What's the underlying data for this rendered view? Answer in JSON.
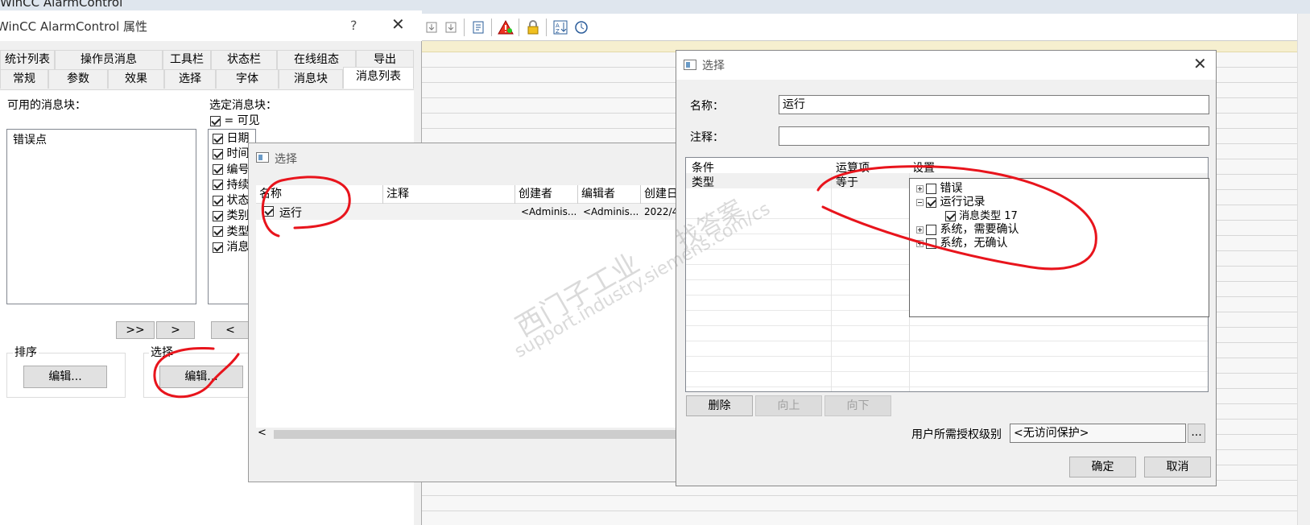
{
  "app": {
    "title": "WinCC AlarmControl"
  },
  "toolbar": {
    "icons": [
      "import-icon",
      "export-icon",
      "properties-icon",
      "alarm-warning-icon",
      "lock-icon",
      "sort-icon",
      "time-base-icon"
    ]
  },
  "properties_dialog": {
    "title": "WinCC AlarmControl 属性",
    "help": "?",
    "close": "✕",
    "tabs_row1": [
      "统计列表",
      "操作员消息",
      "工具栏",
      "状态栏",
      "在线组态",
      "导出"
    ],
    "tabs_row2": [
      "常规",
      "参数",
      "效果",
      "选择",
      "字体",
      "消息块",
      "消息列表"
    ],
    "active_tab": "消息列表",
    "available_label": "可用的消息块：",
    "available_items": [
      "错误点"
    ],
    "selected_label": "选定消息块：",
    "visible_legend": "= 可见",
    "selected_items": [
      {
        "label": "日期",
        "checked": true
      },
      {
        "label": "时间",
        "checked": true
      },
      {
        "label": "编号",
        "checked": true
      },
      {
        "label": "持续",
        "checked": true
      },
      {
        "label": "状态",
        "checked": true
      },
      {
        "label": "类别",
        "checked": true
      },
      {
        "label": "类型",
        "checked": true
      },
      {
        "label": "消息",
        "checked": true
      }
    ],
    "btn_add_all": ">>",
    "btn_add": ">",
    "btn_remove": "<",
    "sort_group": "排序",
    "sort_edit": "编辑...",
    "select_group": "选择",
    "select_edit": "编辑..."
  },
  "selection_dialog": {
    "title": "选择",
    "columns": [
      "名称",
      "注释",
      "创建者",
      "编辑者",
      "创建日"
    ],
    "rows": [
      {
        "checked": true,
        "name": "运行",
        "comment": "",
        "creator": "<Adminis...",
        "editor": "<Adminis...",
        "created": "2022/4"
      }
    ],
    "scroll_left": "<"
  },
  "selection_editor": {
    "title": "选择",
    "close": "✕",
    "name_label": "名称：",
    "name_value": "运行",
    "comment_label": "注释：",
    "comment_value": "",
    "grid_headers": [
      "条件",
      "运算项",
      "设置"
    ],
    "grid_rows": [
      {
        "condition": "类型",
        "operator": "等于"
      }
    ],
    "tree": [
      {
        "label": "错误",
        "expander": "plus",
        "checked": false,
        "level": 0
      },
      {
        "label": "运行记录",
        "expander": "minus",
        "checked": true,
        "level": 0
      },
      {
        "label": "消息类型 17",
        "expander": "none",
        "checked": true,
        "level": 1
      },
      {
        "label": "系统，需要确认",
        "expander": "plus",
        "checked": false,
        "level": 0
      },
      {
        "label": "系统，无确认",
        "expander": "plus",
        "checked": false,
        "level": 0
      }
    ],
    "btn_delete": "删除",
    "btn_up": "向上",
    "btn_down": "向下",
    "auth_label": "用户所需授权级别",
    "auth_value": "<无访问保护>",
    "auth_browse": "...",
    "btn_ok": "确定",
    "btn_cancel": "取消"
  },
  "watermark": {
    "line1": "西门子工业",
    "line2": "support.industry.siemens.com/cs",
    "line3": "找答案"
  },
  "colors": {
    "annotation": "#e8141c",
    "active_tab_bg": "#ffffff",
    "dialog_bg": "#f0f0f0"
  }
}
